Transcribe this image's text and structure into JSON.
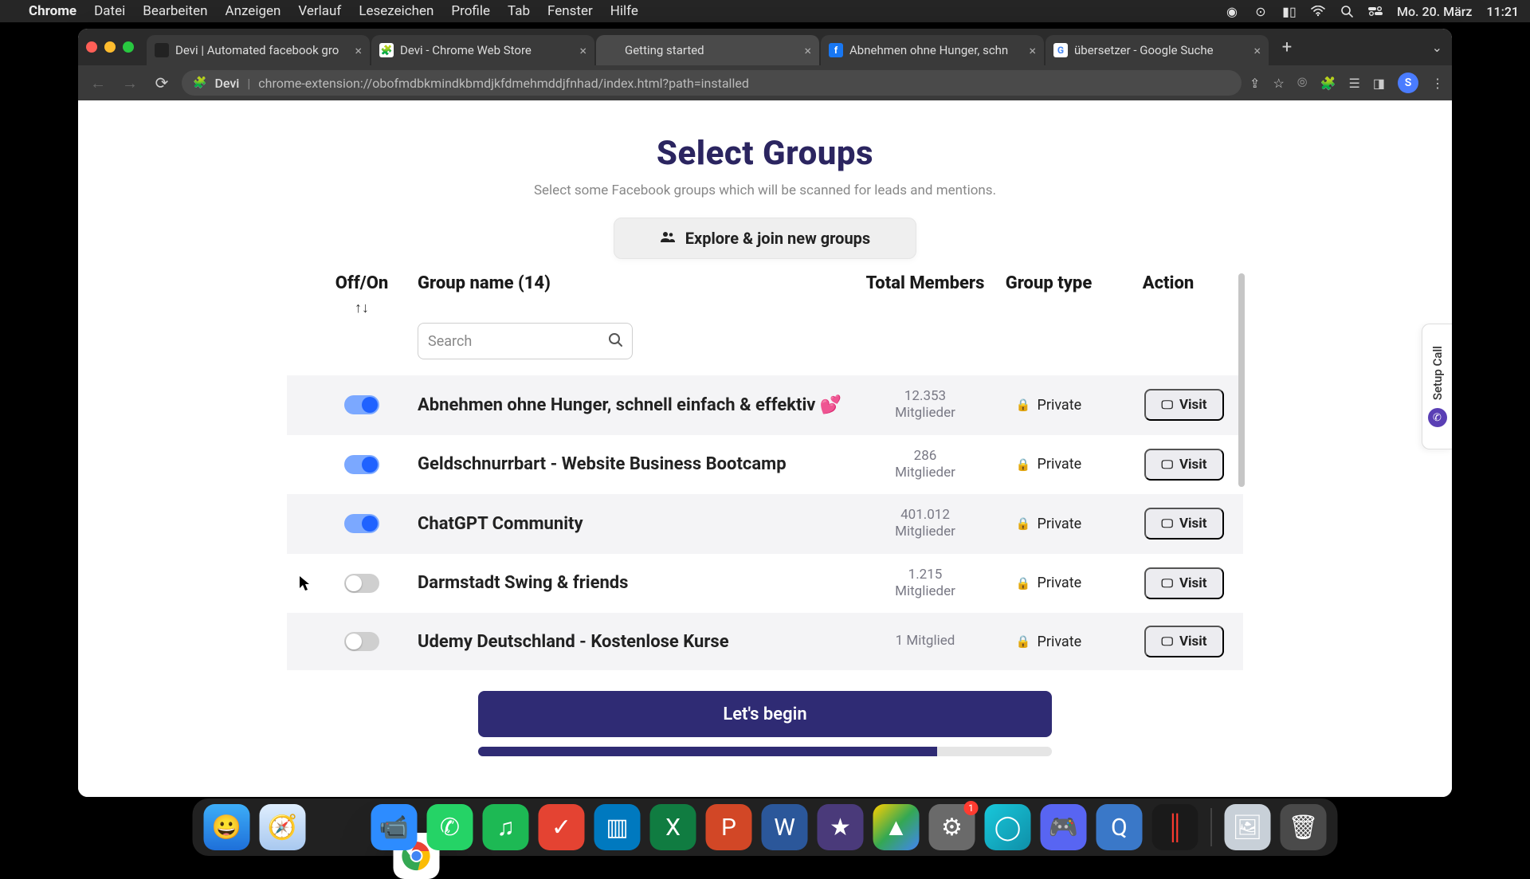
{
  "menubar": {
    "app": "Chrome",
    "items": [
      "Datei",
      "Bearbeiten",
      "Anzeigen",
      "Verlauf",
      "Lesezeichen",
      "Profile",
      "Tab",
      "Fenster",
      "Hilfe"
    ],
    "date": "Mo. 20. März",
    "time": "11:21"
  },
  "tabs": [
    {
      "title": "Devi | Automated facebook gro",
      "favicon_bg": "#222"
    },
    {
      "title": "Devi - Chrome Web Store",
      "favicon_bg": "#fff"
    },
    {
      "title": "Getting started",
      "favicon_bg": "#4a4a4a",
      "active": true
    },
    {
      "title": "Abnehmen ohne Hunger, schn",
      "favicon_bg": "#1877f2"
    },
    {
      "title": "übersetzer - Google Suche",
      "favicon_bg": "#fff"
    }
  ],
  "addr": {
    "ext": "Devi",
    "url": "chrome-extension://obofmdbkmindkbmdjkfdmehmddjfnhad/index.html?path=installed",
    "avatar": "S"
  },
  "page": {
    "title": "Select Groups",
    "subtitle": "Select some Facebook groups which will be scanned for leads and mentions.",
    "explore": "Explore & join new groups",
    "columns": {
      "offon": "Off/On",
      "name": "Group name (14)",
      "members": "Total Members",
      "type": "Group type",
      "action": "Action"
    },
    "search_placeholder": "Search",
    "rows": [
      {
        "on": true,
        "name": "Abnehmen ohne Hunger, schnell einfach & effektiv 💕",
        "members": "12.353",
        "members_unit": "Mitglieder",
        "type": "Private",
        "visit": "Visit"
      },
      {
        "on": true,
        "name": "Geldschnurrbart - Website Business Bootcamp",
        "members": "286",
        "members_unit": "Mitglieder",
        "type": "Private",
        "visit": "Visit"
      },
      {
        "on": true,
        "name": "ChatGPT Community",
        "members": "401.012",
        "members_unit": "Mitglieder",
        "type": "Private",
        "visit": "Visit"
      },
      {
        "on": false,
        "name": "Darmstadt Swing & friends",
        "members": "1.215",
        "members_unit": "Mitglieder",
        "type": "Private",
        "visit": "Visit"
      },
      {
        "on": false,
        "name": "Udemy Deutschland - Kostenlose Kurse",
        "members": "1 Mitglied",
        "members_unit": "",
        "type": "Private",
        "visit": "Visit"
      }
    ],
    "begin": "Let's begin",
    "setup_call": "Setup Call"
  },
  "dock": {
    "apps": [
      "finder",
      "safari",
      "chrome",
      "zoom",
      "whatsapp",
      "spotify",
      "todoist",
      "trello",
      "excel",
      "ppt",
      "word",
      "imovie",
      "drive",
      "settings",
      "siri",
      "discord",
      "qt",
      "voice"
    ],
    "settings_badge": "1"
  }
}
